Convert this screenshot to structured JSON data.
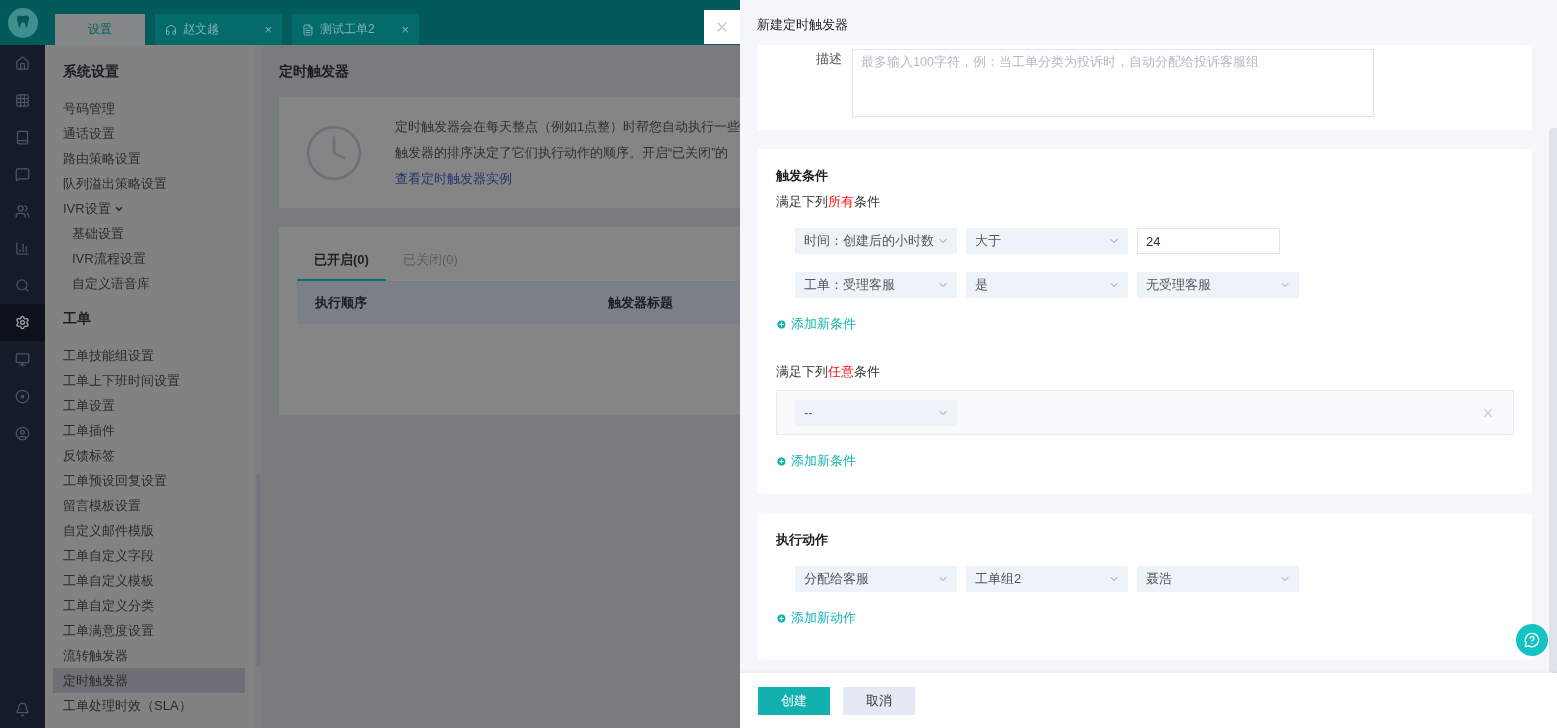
{
  "rail": [
    {
      "selected": false
    },
    {
      "selected": false
    },
    {
      "selected": false
    },
    {
      "selected": false
    },
    {
      "selected": false
    },
    {
      "selected": false
    },
    {
      "selected": false
    },
    {
      "selected": true
    },
    {
      "selected": false
    },
    {
      "selected": false
    },
    {
      "selected": false
    },
    {
      "selected": false
    }
  ],
  "tabs": [
    {
      "label": "设置",
      "selected": true,
      "closable": false
    },
    {
      "label": "赵文越",
      "selected": false,
      "closable": true,
      "kind": "agent"
    },
    {
      "label": "测试工单2",
      "selected": false,
      "closable": true,
      "kind": "ticket"
    }
  ],
  "close_symbol": "×",
  "sidebar": {
    "groups": [
      {
        "title": "系统设置",
        "items": [
          {
            "label": "号码管理",
            "selected": false
          },
          {
            "label": "通话设置",
            "selected": false
          },
          {
            "label": "路由策略设置",
            "selected": false
          },
          {
            "label": "队列溢出策略设置",
            "selected": false
          },
          {
            "label": "IVR设置",
            "selected": false,
            "expanded": true,
            "children": [
              {
                "label": "基础设置",
                "selected": false
              },
              {
                "label": "IVR流程设置",
                "selected": false
              },
              {
                "label": "自定义语音库",
                "selected": false
              }
            ]
          }
        ]
      },
      {
        "title": "工单",
        "items": [
          {
            "label": "工单技能组设置",
            "selected": false
          },
          {
            "label": "工单上下班时间设置",
            "selected": false
          },
          {
            "label": "工单设置",
            "selected": false
          },
          {
            "label": "工单插件",
            "selected": false
          },
          {
            "label": "反馈标签",
            "selected": false
          },
          {
            "label": "工单预设回复设置",
            "selected": false
          },
          {
            "label": "留言模板设置",
            "selected": false
          },
          {
            "label": "自定义邮件模版",
            "selected": false
          },
          {
            "label": "工单自定义字段",
            "selected": false
          },
          {
            "label": "工单自定义模板",
            "selected": false
          },
          {
            "label": "工单自定义分类",
            "selected": false
          },
          {
            "label": "工单满意度设置",
            "selected": false
          },
          {
            "label": "流转触发器",
            "selected": false
          },
          {
            "label": "定时触发器",
            "selected": true
          },
          {
            "label": "工单处理时效（SLA）",
            "selected": false
          }
        ]
      }
    ]
  },
  "main": {
    "title": "定时触发器",
    "info": {
      "lines": [
        "定时触发器会在每天整点（例如1点整）时帮您自动执行一些",
        "触发器的排序决定了它们执行动作的顺序。开启“已关闭”的"
      ],
      "link": "查看定时触发器实例"
    },
    "tabs": [
      {
        "label": "已开启(0)",
        "selected": true
      },
      {
        "label": "已关闭(0)",
        "selected": false
      }
    ],
    "table": {
      "columns": [
        "执行顺序",
        "触发器标题"
      ]
    }
  },
  "drawer": {
    "title": "新建定时触发器",
    "description": {
      "label": "描述",
      "placeholder": "最多输入100字符，例：当工单分类为投诉时，自动分配给投诉客服组"
    },
    "conditions": {
      "title": "触发条件",
      "all": {
        "heading": {
          "before": "满足下列",
          "emphasis": "所有",
          "after": "条件"
        },
        "rows": [
          {
            "fields": [
              {
                "kind": "select",
                "value": "时间：创建后的小时数"
              },
              {
                "kind": "select",
                "value": "大于"
              },
              {
                "kind": "input",
                "value": "24"
              }
            ]
          },
          {
            "fields": [
              {
                "kind": "select",
                "value": "工单：受理客服"
              },
              {
                "kind": "select",
                "value": "是"
              },
              {
                "kind": "select",
                "value": "无受理客服"
              }
            ]
          }
        ],
        "add_link": "添加新条件"
      },
      "any": {
        "heading": {
          "before": "满足下列",
          "emphasis": "任意",
          "after": "条件"
        },
        "rows": [
          {
            "fields": [
              {
                "kind": "select",
                "value": "--"
              }
            ],
            "removable": true
          }
        ],
        "add_link": "添加新条件"
      }
    },
    "actions": {
      "title": "执行动作",
      "rows": [
        {
          "fields": [
            {
              "kind": "select",
              "value": "分配给客服"
            },
            {
              "kind": "select",
              "value": "工单组2"
            },
            {
              "kind": "select",
              "value": "聂浩"
            }
          ]
        }
      ],
      "add_link": "添加新动作"
    },
    "buttons": [
      {
        "label": "创建",
        "kind": "primary"
      },
      {
        "label": "取消",
        "kind": "secondary"
      }
    ]
  }
}
